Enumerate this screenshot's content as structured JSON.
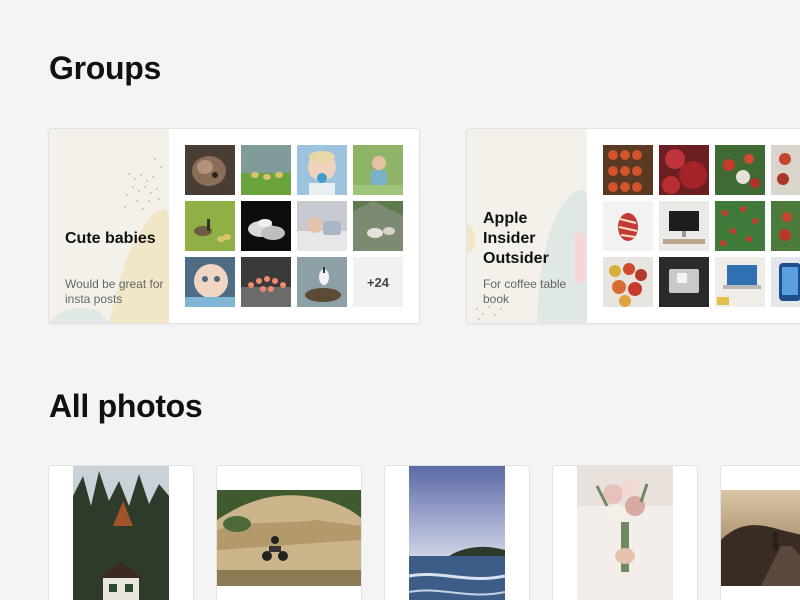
{
  "groups_section": {
    "title": "Groups"
  },
  "groups": [
    {
      "name": "Cute babies",
      "description": "Would be great for insta posts",
      "thumbnails": [
        "kitten-photo",
        "ducklings-photo",
        "baby-pacifier-photo",
        "toddler-outdoors-photo",
        "geese-photo",
        "baby-feet-photo",
        "baby-bed-photo",
        "goats-rocks-photo",
        "baby-face-photo",
        "toy-figures-photo",
        "stork-nest-photo"
      ],
      "more_count": "+24"
    },
    {
      "name": "Apple Insider Outsider",
      "description": "For coffee table book",
      "thumbnails": [
        "apple-crates-photo",
        "pomegranates-photo",
        "apple-tree-photo",
        "apples-partial-photo",
        "peeled-apple-photo",
        "imac-desk-photo",
        "apple-orchard-photo",
        "apple-branch-photo",
        "apple-pile-photo",
        "magic-trackpad-photo",
        "macbook-desk-photo",
        "iphone-photo"
      ]
    }
  ],
  "photos_section": {
    "title": "All photos"
  },
  "photos": [
    {
      "name": "forest-cabin-photo"
    },
    {
      "name": "motorcycle-dirt-photo"
    },
    {
      "name": "sea-shore-photo"
    },
    {
      "name": "bridal-bouquet-photo"
    },
    {
      "name": "sunset-road-photo"
    }
  ],
  "colors": {
    "background": "#f4f4f4",
    "card": "#ffffff",
    "cover": "#f4f1ea",
    "more_tile": "#f1f1f1"
  }
}
